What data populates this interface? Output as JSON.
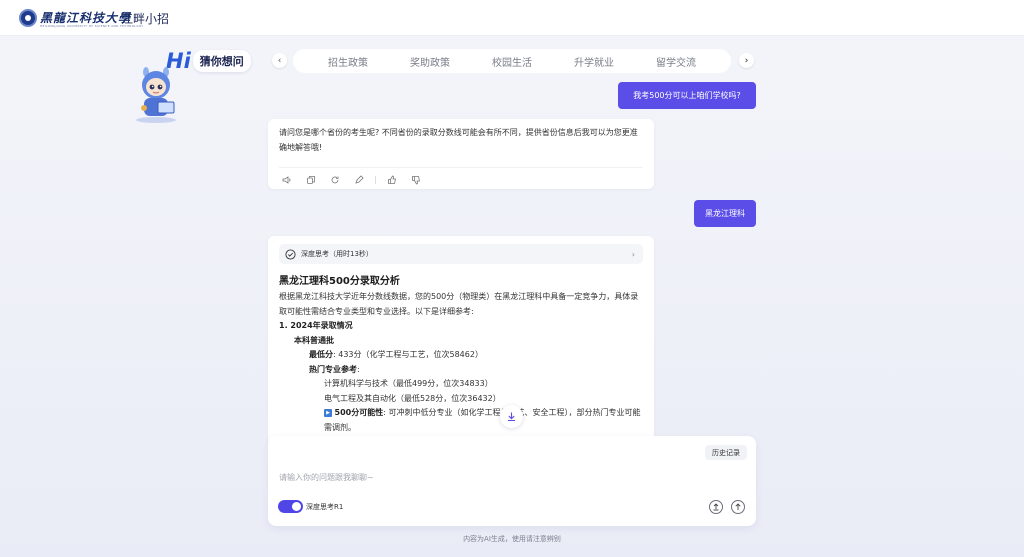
{
  "header": {
    "logo_text": "黑龍江科技大學",
    "logo_subtext": "HEILONGJIANG UNIVERSITY OF SCIENCE AND TECHNOLOGY",
    "app_title": "江畔小招"
  },
  "hero": {
    "hi": "Hi",
    "guess": "猜你想问"
  },
  "tabs": {
    "items": [
      "招生政策",
      "奖助政策",
      "校园生活",
      "升学就业",
      "留学交流"
    ],
    "prev_icon": "chevron-left-icon",
    "next_icon": "chevron-right-icon"
  },
  "conversation": {
    "user_msg_1": "我考500分可以上咱们学校吗?",
    "bot_msg_1": "请问您是哪个省份的考生呢? 不同省份的录取分数线可能会有所不同，提供省份信息后我可以为您更准确地解答哦!",
    "user_msg_2": "黑龙江理科",
    "think_label": "深度思考（用时13秒）",
    "analysis_title": "黑龙江理科500分录取分析",
    "analysis_intro": "根据黑龙江科技大学近年分数线数据，您的500分（物理类）在黑龙江理科中具备一定竞争力，具体录取可能性需结合专业类型和专业选择。以下是详细参考:",
    "section_1": "1. 2024年录取情况",
    "batch": "本科普通批",
    "min_score_label": "最低分",
    "min_score_value": ": 433分（化学工程与工艺，位次58462）",
    "hot_label": "热门专业参考",
    "hot_suffix": ":",
    "hot_1": "计算机科学与技术（最低499分，位次34833）",
    "hot_2": "电气工程及其自动化（最低528分，位次36432）",
    "possibility_label": "500分可能性",
    "possibility_text": ": 可冲刺中低分专业（如化学工程与工艺、安全工程），部分热门专业可能需调剂。"
  },
  "toolbar_icons": [
    "speaker-icon",
    "copy-icon",
    "refresh-icon",
    "edit-icon",
    "thumbs-up-icon",
    "thumbs-down-icon"
  ],
  "input": {
    "history_label": "历史记录",
    "placeholder": "请输入你的问题跟我聊聊~",
    "toggle_label": "深度思考R1",
    "toggle_on": true
  },
  "footer": {
    "note": "内容为AI生成，使用请注意辨别"
  },
  "colors": {
    "accent": "#5b4de8",
    "hi_blue": "#2b5bd7"
  }
}
